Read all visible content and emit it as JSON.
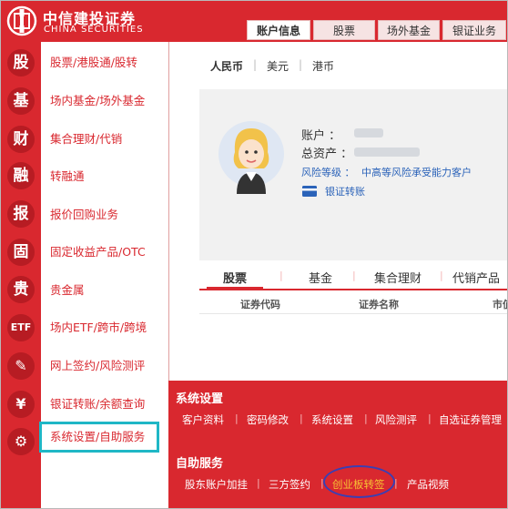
{
  "brand": {
    "name_cn": "中信建投证券",
    "name_en": "CHINA SECURITIES"
  },
  "sidebar": {
    "items": [
      {
        "icon": "股",
        "icon_name": "stock-icon",
        "label": "股票/港股通/股转"
      },
      {
        "icon": "基",
        "icon_name": "fund-icon",
        "label": "场内基金/场外基金"
      },
      {
        "icon": "财",
        "icon_name": "wealth-icon",
        "label": "集合理财/代销"
      },
      {
        "icon": "融",
        "icon_name": "finance-icon",
        "label": "转融通"
      },
      {
        "icon": "报",
        "icon_name": "repo-icon",
        "label": "报价回购业务"
      },
      {
        "icon": "固",
        "icon_name": "fixed-income-icon",
        "label": "固定收益产品/OTC"
      },
      {
        "icon": "贵",
        "icon_name": "precious-metal-icon",
        "label": "贵金属"
      },
      {
        "icon": "ETF",
        "icon_name": "etf-icon",
        "label": "场内ETF/跨市/跨境"
      },
      {
        "icon": "✎",
        "icon_name": "sign-icon",
        "label": "网上签约/风险测评"
      },
      {
        "icon": "¥",
        "icon_name": "yen-icon",
        "label": "银证转账/余额查询"
      },
      {
        "icon": "⚙",
        "icon_name": "gear-icon",
        "label": "系统设置/自助服务"
      }
    ]
  },
  "top_tabs": [
    "账户信息",
    "股票",
    "场外基金",
    "银证业务"
  ],
  "currency_tabs": [
    "人民币",
    "美元",
    "港币"
  ],
  "account": {
    "account_label": "账户 ：",
    "assets_label": "总资产 ：",
    "risk_label": "风险等级 ：",
    "risk_value": "中高等风险承受能力客户",
    "transfer_label": "银证转账"
  },
  "product_tabs": [
    "股票",
    "基金",
    "集合理财",
    "代销产品"
  ],
  "table_headers": [
    "证券代码",
    "证券名称",
    "市值"
  ],
  "settings_panel": {
    "system_title": "系统设置",
    "system_links": [
      "客户资料",
      "密码修改",
      "系统设置",
      "风险测评",
      "自选证券管理"
    ],
    "self_title": "自助服务",
    "self_links": [
      "股东账户加挂",
      "三方签约",
      "创业板转签",
      "产品视频"
    ]
  },
  "colors": {
    "brand_red": "#d9282f",
    "highlight": "#1fb7c6",
    "circle": "#3a3fb4",
    "link_yellow": "#f7c332"
  }
}
